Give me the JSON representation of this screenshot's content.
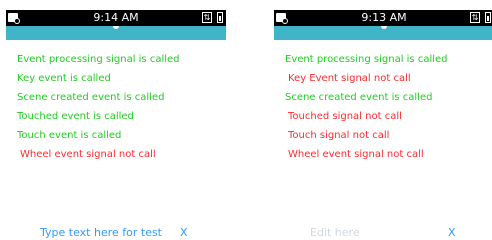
{
  "screens": [
    {
      "status_time": "9:14 AM",
      "signal_glyph": "⇅",
      "logs": [
        {
          "text": "Event processing signal is called",
          "status": "ok"
        },
        {
          "text": "Key event is called",
          "status": "ok"
        },
        {
          "text": "Scene created event is called",
          "status": "ok"
        },
        {
          "text": "Touched event is called",
          "status": "ok"
        },
        {
          "text": "Touch event is called",
          "status": "ok"
        },
        {
          "text": "Wheel event signal not call",
          "status": "fail"
        }
      ],
      "input_placeholder": "Type text here for test",
      "clear_label": "X"
    },
    {
      "status_time": "9:13 AM",
      "signal_glyph": "⇅",
      "logs": [
        {
          "text": "Event processing signal is called",
          "status": "ok"
        },
        {
          "text": "Key Event signal not call",
          "status": "fail"
        },
        {
          "text": "Scene created event is called",
          "status": "ok"
        },
        {
          "text": "Touched signal not call",
          "status": "fail"
        },
        {
          "text": "Touch signal not call",
          "status": "fail"
        },
        {
          "text": "Wheel event signal not call",
          "status": "fail"
        }
      ],
      "input_placeholder": "Edit here",
      "clear_label": "X"
    }
  ],
  "colors": {
    "header": "#40b5c7",
    "ok": "#22cc22",
    "fail": "#ff2a2a",
    "accent": "#3399ff"
  }
}
